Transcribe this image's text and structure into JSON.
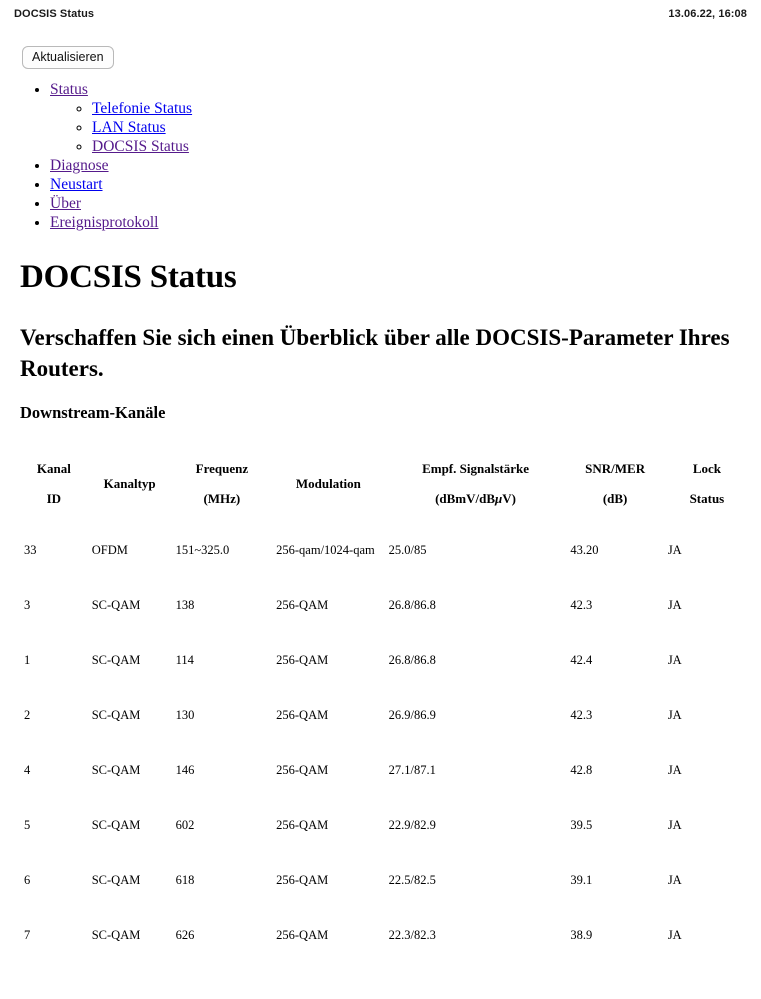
{
  "topbar": {
    "title": "DOCSIS Status",
    "datetime": "13.06.22, 16:08"
  },
  "toolbar": {
    "refresh_label": "Aktualisieren"
  },
  "nav": {
    "items": [
      {
        "label": "Status",
        "state": "visited"
      },
      {
        "label": "Telefonie Status",
        "state": "unvisited"
      },
      {
        "label": "LAN Status",
        "state": "unvisited"
      },
      {
        "label": "DOCSIS Status",
        "state": "visited"
      },
      {
        "label": "Diagnose",
        "state": "visited"
      },
      {
        "label": "Neustart",
        "state": "unvisited"
      },
      {
        "label": "Über",
        "state": "visited"
      },
      {
        "label": "Ereignisprotokoll",
        "state": "visited"
      }
    ]
  },
  "page": {
    "title": "DOCSIS Status",
    "subtitle": "Verschaffen Sie sich einen Überblick über alle DOCSIS-Parameter Ihres Routers.",
    "section_title": "Downstream-Kanäle"
  },
  "table": {
    "headers": {
      "id_l1": "Kanal",
      "id_l2": "ID",
      "type_l1": "Kanaltyp",
      "type_l2": "",
      "freq_l1": "Frequenz",
      "freq_l2": "(MHz)",
      "mod_l1": "Modulation",
      "mod_l2": "",
      "pow_l1": "Empf. Signalstärke",
      "pow_l2a": "(dBmV/dB",
      "pow_l2mu": "μ",
      "pow_l2b": "V)",
      "snr_l1": "SNR/MER",
      "snr_l2": "(dB)",
      "lock_l1": "Lock",
      "lock_l2": "Status"
    },
    "rows": [
      {
        "id": "33",
        "type": "OFDM",
        "freq": "151~325.0",
        "mod": "256-qam/1024-qam",
        "power": "25.0/85",
        "snr": "43.20",
        "lock": "JA"
      },
      {
        "id": "3",
        "type": "SC-QAM",
        "freq": "138",
        "mod": "256-QAM",
        "power": "26.8/86.8",
        "snr": "42.3",
        "lock": "JA"
      },
      {
        "id": "1",
        "type": "SC-QAM",
        "freq": "114",
        "mod": "256-QAM",
        "power": "26.8/86.8",
        "snr": "42.4",
        "lock": "JA"
      },
      {
        "id": "2",
        "type": "SC-QAM",
        "freq": "130",
        "mod": "256-QAM",
        "power": "26.9/86.9",
        "snr": "42.3",
        "lock": "JA"
      },
      {
        "id": "4",
        "type": "SC-QAM",
        "freq": "146",
        "mod": "256-QAM",
        "power": "27.1/87.1",
        "snr": "42.8",
        "lock": "JA"
      },
      {
        "id": "5",
        "type": "SC-QAM",
        "freq": "602",
        "mod": "256-QAM",
        "power": "22.9/82.9",
        "snr": "39.5",
        "lock": "JA"
      },
      {
        "id": "6",
        "type": "SC-QAM",
        "freq": "618",
        "mod": "256-QAM",
        "power": "22.5/82.5",
        "snr": "39.1",
        "lock": "JA"
      },
      {
        "id": "7",
        "type": "SC-QAM",
        "freq": "626",
        "mod": "256-QAM",
        "power": "22.3/82.3",
        "snr": "38.9",
        "lock": "JA"
      }
    ]
  },
  "colors": {
    "link_visited": "#551a8b",
    "link_unvisited": "#0000ee",
    "text": "#000000",
    "background": "#ffffff"
  }
}
